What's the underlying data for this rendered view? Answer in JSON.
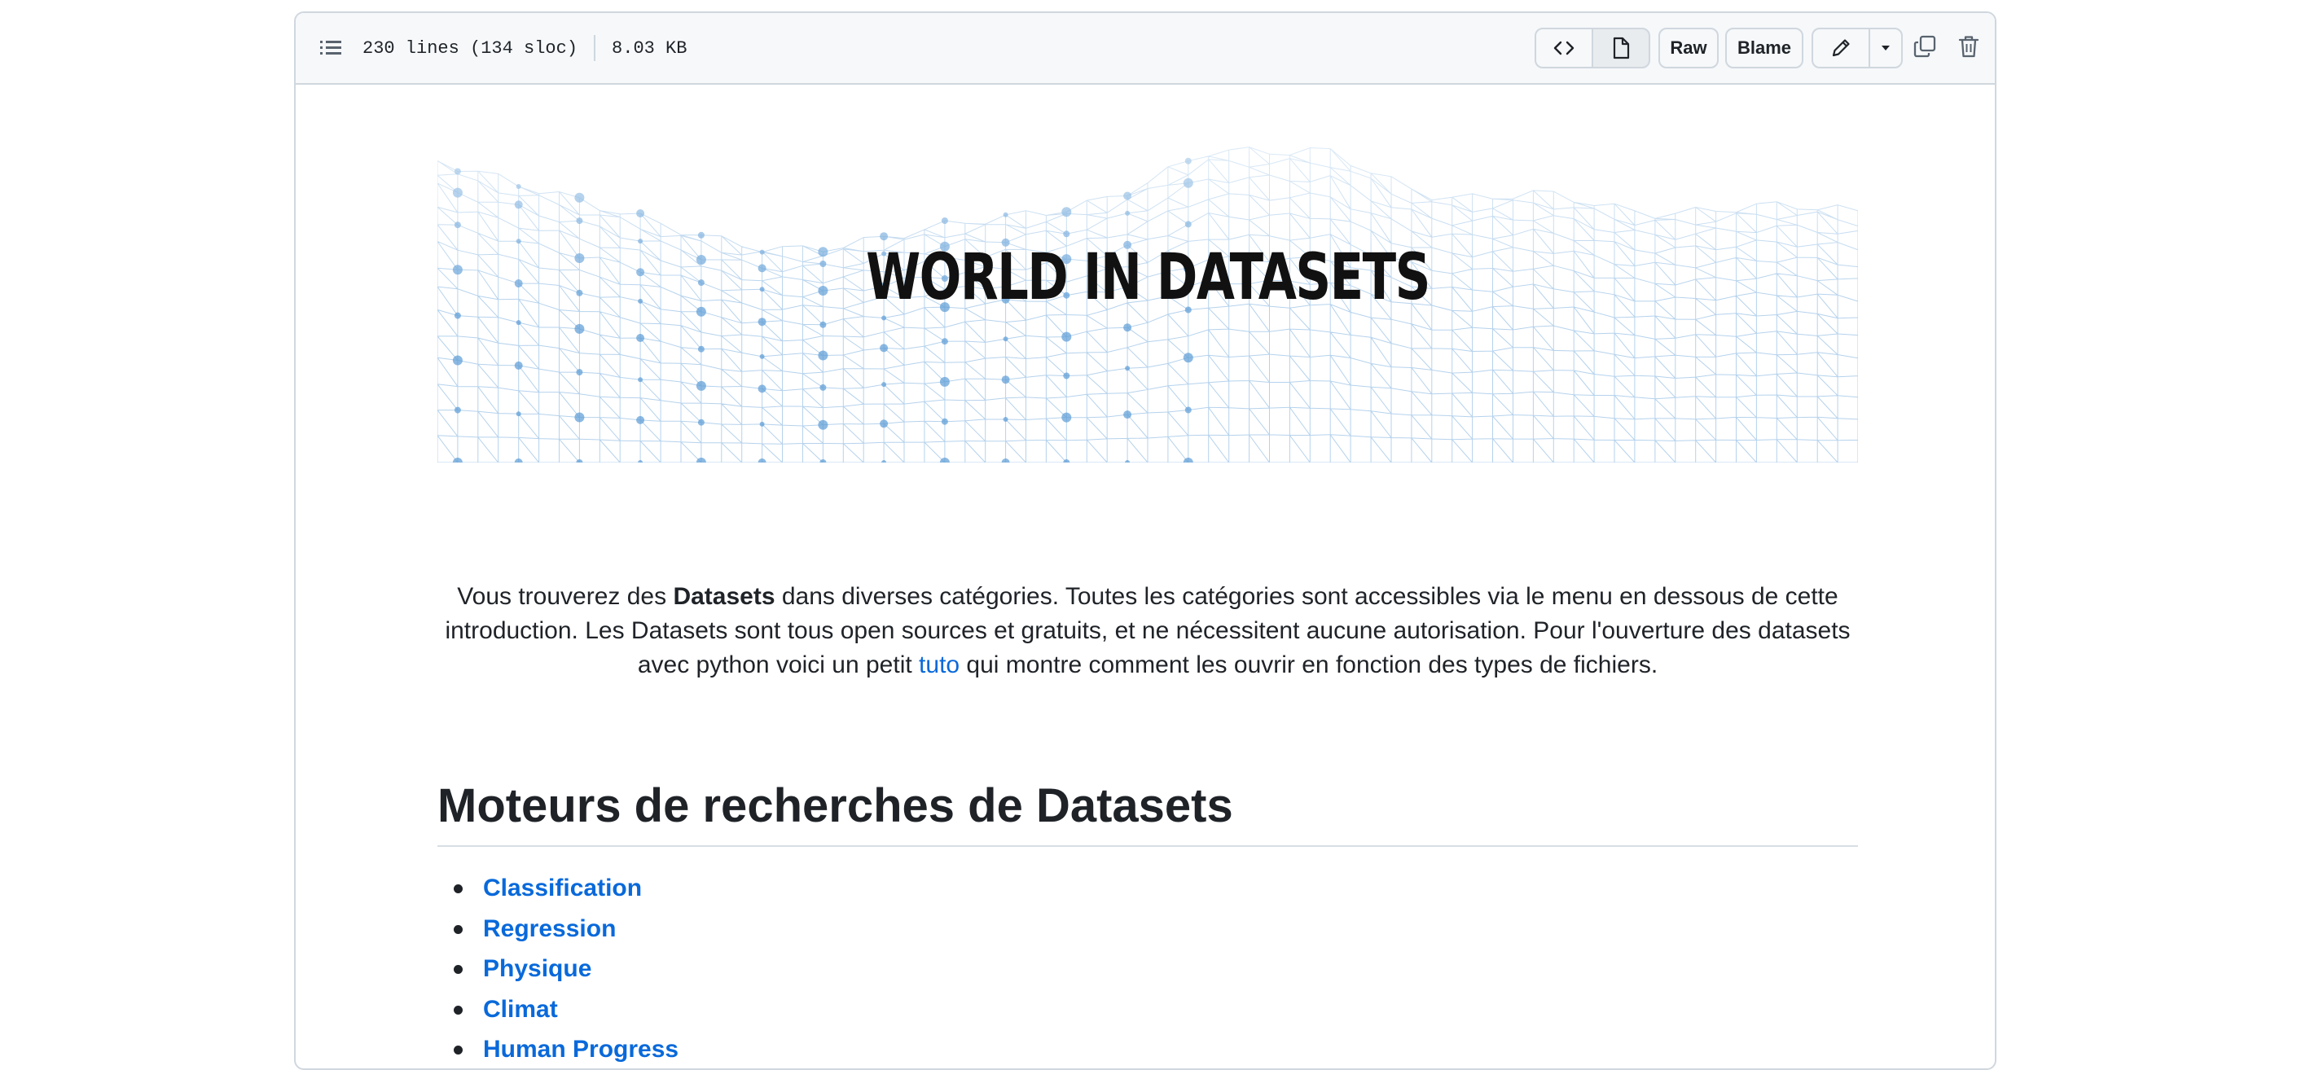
{
  "file_header": {
    "lines_info": "230 lines (134 sloc)",
    "size": "8.03 KB",
    "raw_label": "Raw",
    "blame_label": "Blame"
  },
  "icons": {
    "toc": "list-unordered-icon",
    "code": "code-icon",
    "preview": "file-icon",
    "edit": "pencil-icon",
    "dropdown": "triangle-down-icon",
    "copy": "copy-icon",
    "delete": "trash-icon"
  },
  "banner": {
    "title": "WORLD IN DATASETS"
  },
  "intro": {
    "part1": "Vous trouverez des ",
    "bold": "Datasets",
    "part2": " dans diverses catégories. Toutes les catégories sont accessibles via le menu en dessous de cette introduction. Les Datasets sont tous open sources et gratuits, et ne nécessitent aucune autorisation. Pour l'ouverture des datasets avec python voici un petit ",
    "link": "tuto",
    "part3": " qui montre comment les ouvrir en fonction des types de fichiers."
  },
  "section": {
    "heading": "Moteurs de recherches de Datasets",
    "items": [
      "Classification",
      "Regression",
      "Physique",
      "Climat",
      "Human Progress"
    ]
  },
  "colors": {
    "link": "#0969da",
    "border": "#d0d7de",
    "header_bg": "#f6f8fa",
    "mesh": "#5b9bd5"
  }
}
